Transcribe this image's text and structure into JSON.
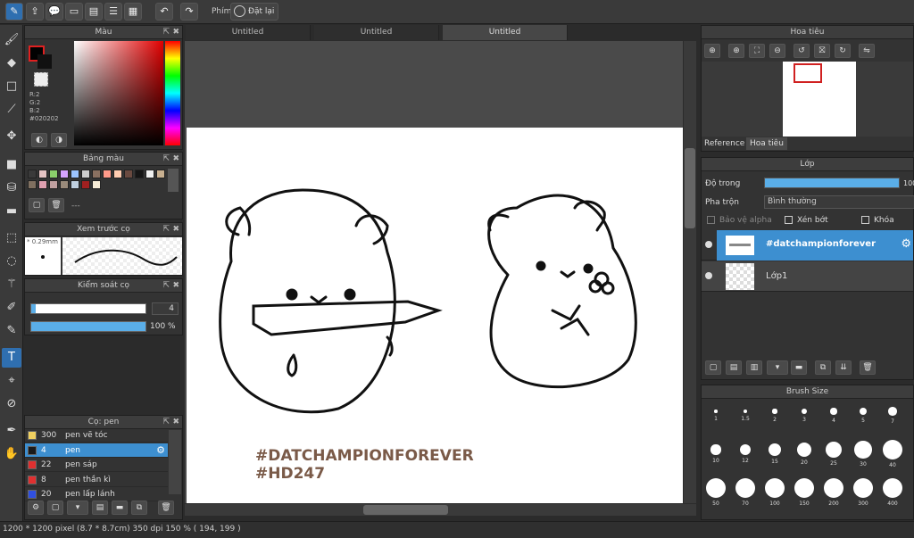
{
  "toolbar": {
    "phim_label": "Phím",
    "reset_label": "Đặt lại"
  },
  "tabs": [
    "Untitled",
    "Untitled",
    "Untitled"
  ],
  "color_panel": {
    "title": "Màu",
    "r": "R:2",
    "g": "G:2",
    "b": "B:2",
    "hex": "#020202",
    "fg_color": "#020202"
  },
  "palette_panel": {
    "title": "Bảng màu",
    "dash": "---",
    "swatches": [
      "#3a3a3a",
      "#e5c3c3",
      "#8bd06b",
      "#d5a4ff",
      "#9cc4ff",
      "#cfcfcf",
      "#8a7060",
      "#ff9a8a",
      "#ffccb0",
      "#6a4a40",
      "#151515",
      "#f0f0f0",
      "#c8b090",
      "#807060",
      "#e0a0b0",
      "#c0a0a0",
      "#9a8a7a",
      "#c0d0e0",
      "#a02020",
      "#f6ecd6"
    ]
  },
  "preview_panel": {
    "title": "Xem trước cọ",
    "size": "* 0.29mm"
  },
  "brush_control": {
    "title": "Kiểm soát cọ",
    "size_value": "4",
    "opacity_value": "100 %",
    "size_level": 0.04,
    "opacity_level": 1.0
  },
  "brush_panel": {
    "title": "Cọ: pen",
    "items": [
      {
        "size": "300",
        "name": "pen vẽ tóc",
        "color": "#f0d060"
      },
      {
        "size": "4",
        "name": "pen",
        "color": "#1a1a1a",
        "selected": true
      },
      {
        "size": "22",
        "name": "pen sáp",
        "color": "#e03030"
      },
      {
        "size": "8",
        "name": "pen thần kì",
        "color": "#e03030"
      },
      {
        "size": "20",
        "name": "pen lấp lánh",
        "color": "#3050e0"
      }
    ]
  },
  "canvas_text": {
    "line1": "#DATCHAMPIONFOREVER",
    "line2": "#HD247"
  },
  "navigator": {
    "title": "Hoa tiêu",
    "tab_reference": "Reference",
    "tab_navigator": "Hoa tiêu"
  },
  "layer_panel": {
    "title": "Lớp",
    "opacity_label": "Độ trong",
    "opacity_value": "100",
    "opacity_level": 1.0,
    "blend_label": "Pha trộn",
    "blend_value": "Bình thường",
    "protect_alpha": "Bảo vệ alpha",
    "clipping": "Xén bớt",
    "lock": "Khóa",
    "layers": [
      {
        "name": "#datchampionforever",
        "selected": true
      },
      {
        "name": "Lớp1",
        "selected": false
      }
    ]
  },
  "brush_size_panel": {
    "title": "Brush Size",
    "sizes": [
      "1",
      "1.5",
      "2",
      "3",
      "4",
      "5",
      "7",
      "10",
      "12",
      "15",
      "20",
      "25",
      "30",
      "40",
      "50",
      "70",
      "100",
      "150",
      "200",
      "300",
      "400"
    ]
  },
  "status_bar": {
    "text": "1200 * 1200 pixel  (8.7 * 8.7cm)  350 dpi  150 %  ( 194, 199 )"
  }
}
